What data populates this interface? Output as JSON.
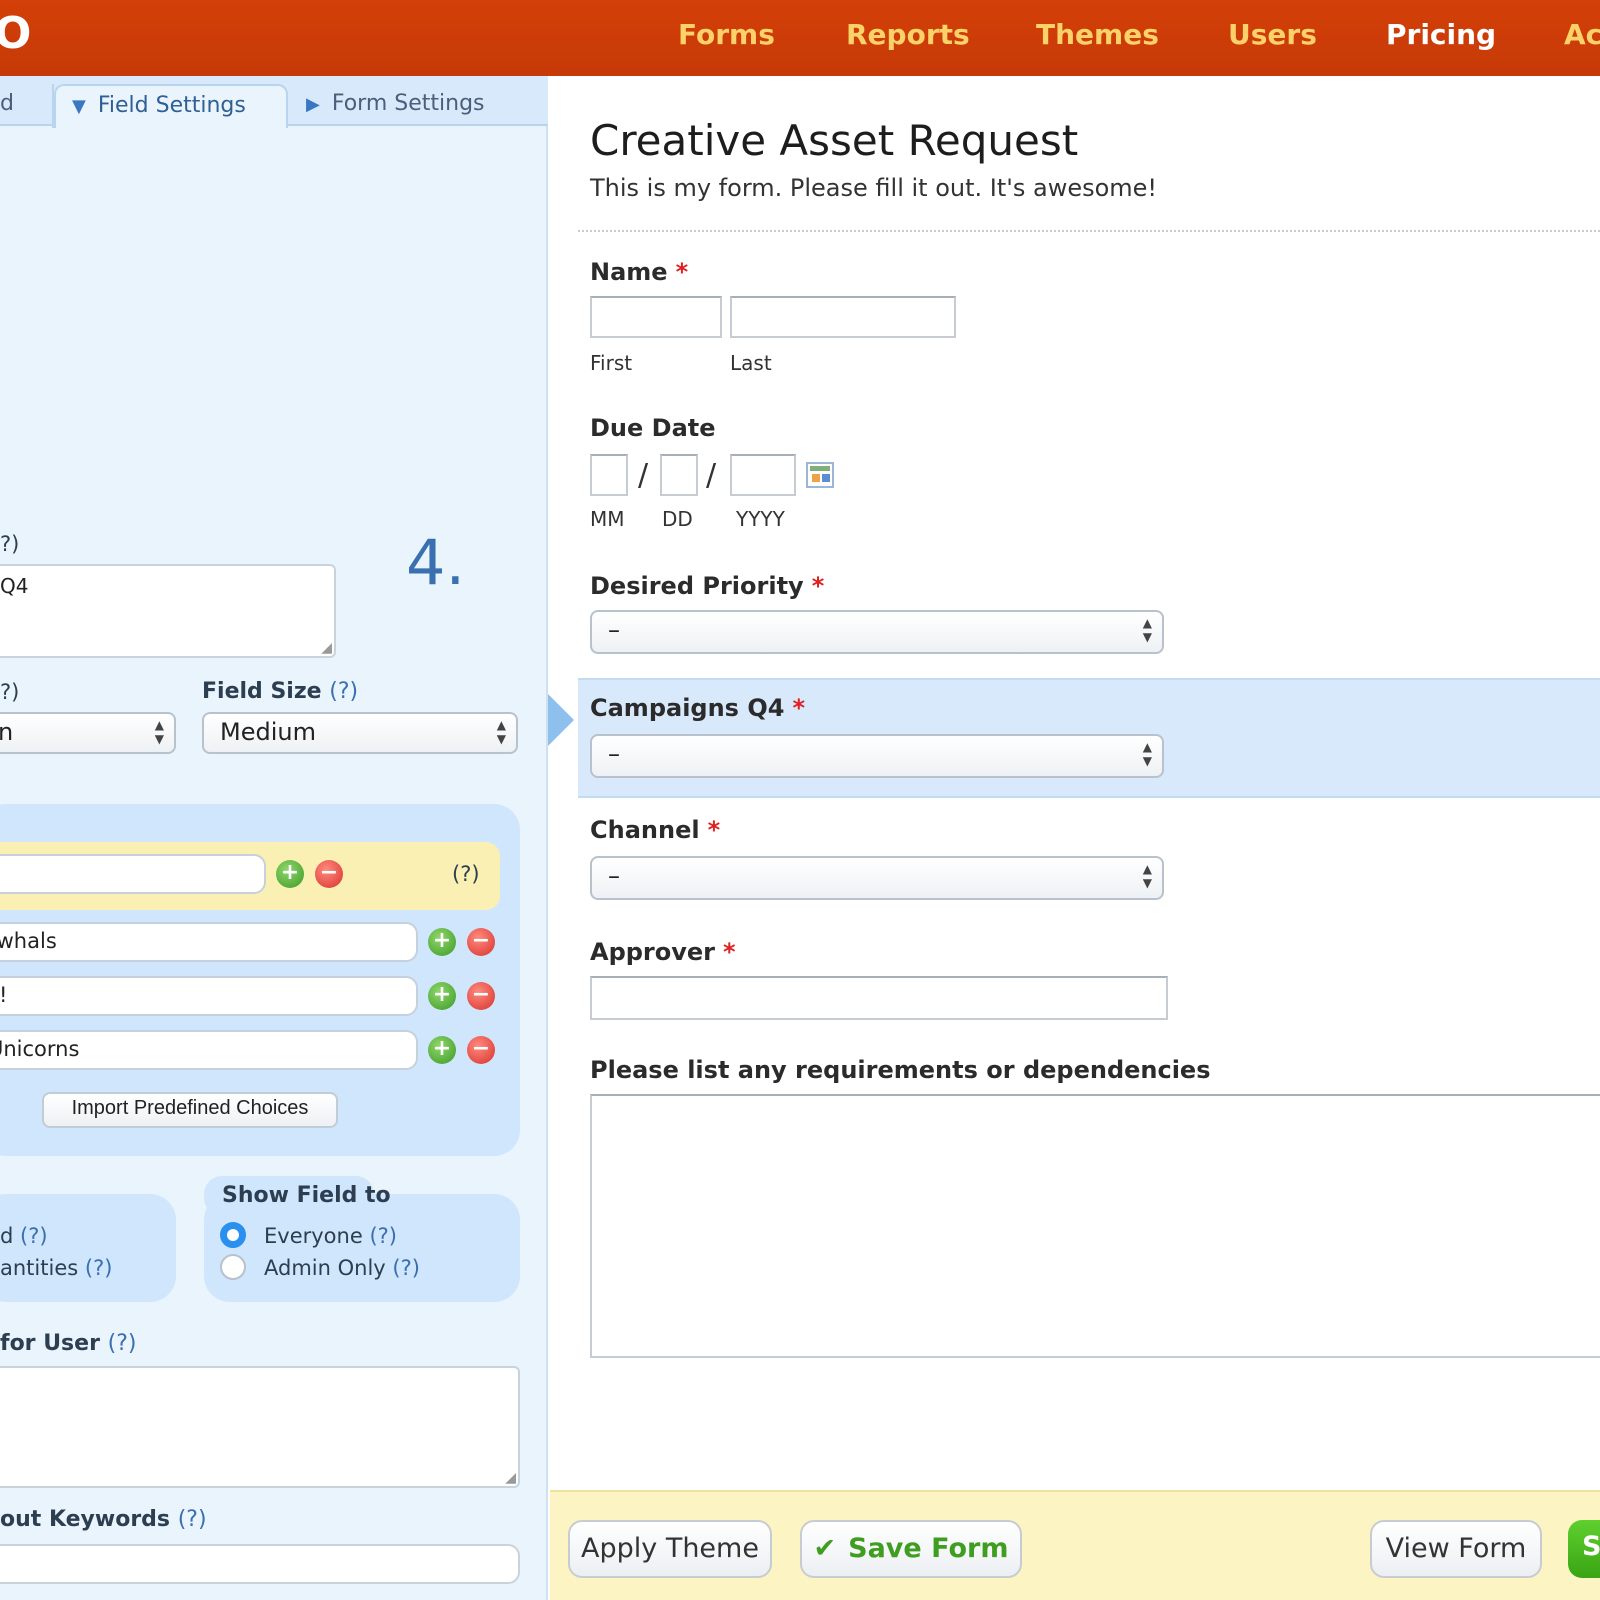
{
  "nav": {
    "logo": "O",
    "items": [
      "Forms",
      "Reports",
      "Themes",
      "Users",
      "Pricing",
      "Ac"
    ]
  },
  "tabs": {
    "add_field_partial": "d",
    "field_settings": "Field Settings",
    "form_settings": "Form Settings"
  },
  "field_settings": {
    "field_label_help": "?)",
    "field_label_value": "Q4",
    "step_marker": "4.",
    "field_type_help": "?)",
    "field_type_value": "n",
    "field_size_label": "Field Size",
    "field_size_help": "(?)",
    "field_size_value": "Medium",
    "choices_help": "(?)",
    "choices": [
      "",
      "rwhals",
      "s!",
      "Unicorns"
    ],
    "import_button": "Import Predefined Choices",
    "options_partial": [
      {
        "text": "d",
        "help": "(?)"
      },
      {
        "text": "antities",
        "help": "(?)"
      }
    ],
    "show_field_to_label": "Show Field to",
    "show_field_to_options": [
      {
        "label": "Everyone",
        "help": "(?)",
        "selected": true
      },
      {
        "label": "Admin Only",
        "help": "(?)",
        "selected": false
      }
    ],
    "instructions_label": "for User",
    "instructions_help": "(?)",
    "keywords_label": "out Keywords",
    "keywords_help": "(?)"
  },
  "form": {
    "title": "Creative Asset Request",
    "description": "This is my form. Please fill it out. It's awesome!",
    "fields": {
      "name_label": "Name",
      "name_first": "First",
      "name_last": "Last",
      "due_date_label": "Due Date",
      "due_mm": "MM",
      "due_dd": "DD",
      "due_yyyy": "YYYY",
      "priority_label": "Desired Priority",
      "priority_value": "–",
      "campaigns_label": "Campaigns Q4",
      "campaigns_value": "–",
      "channel_label": "Channel",
      "channel_value": "–",
      "approver_label": "Approver",
      "requirements_label": "Please list any requirements or dependencies"
    },
    "required_mark": "*",
    "date_sep": "/"
  },
  "footer": {
    "apply_theme": "Apply Theme",
    "save_form": "Save Form",
    "save_check": "✔",
    "view_form": "View Form",
    "next_partial": "S"
  },
  "colors": {
    "topbar": "#c63a07",
    "nav_text": "#fbd26a",
    "accent_blue": "#3a6fb0",
    "required": "#e02020"
  }
}
